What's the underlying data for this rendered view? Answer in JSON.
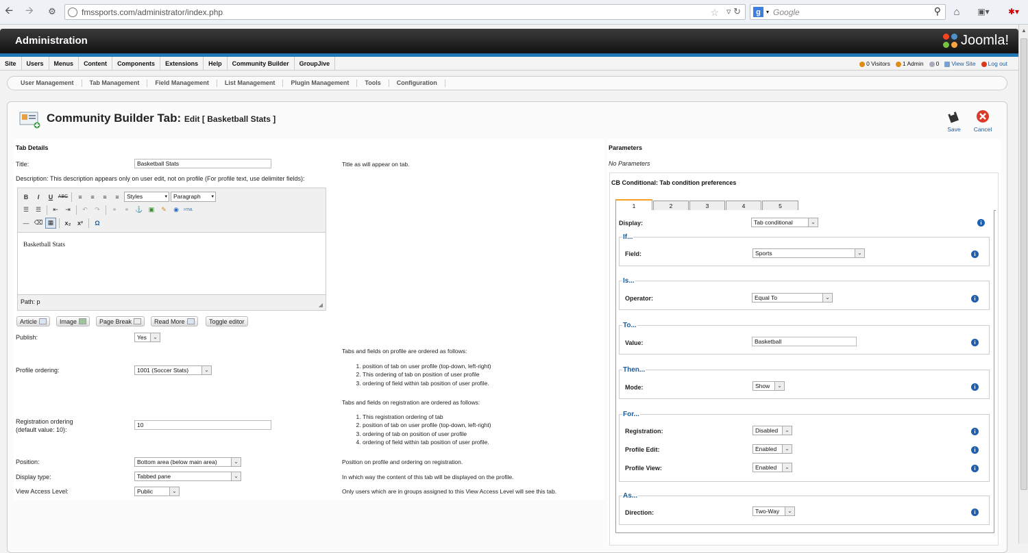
{
  "browser": {
    "url": "fmssports.com/administrator/index.php",
    "search_engine_letter": "g",
    "search_placeholder": "Google"
  },
  "header": {
    "title": "Administration",
    "logo_text": "Joomla!"
  },
  "menu": {
    "items": [
      "Site",
      "Users",
      "Menus",
      "Content",
      "Components",
      "Extensions",
      "Help",
      "Community Builder",
      "GroupJive"
    ],
    "visitors": "0 Visitors",
    "admin": "1 Admin",
    "messages": "0",
    "view_site": "View Site",
    "logout": "Log out"
  },
  "submenu": [
    "User Management",
    "Tab Management",
    "Field Management",
    "List Management",
    "Plugin Management",
    "Tools",
    "Configuration"
  ],
  "page": {
    "title_main": "Community Builder Tab:",
    "title_sub": "Edit [ Basketball Stats ]",
    "save_label": "Save",
    "cancel_label": "Cancel"
  },
  "tab_details": {
    "heading": "Tab Details",
    "title_label": "Title:",
    "title_value": "Basketball Stats",
    "title_help": "Title as will appear on tab.",
    "description_label": "Description: This description appears only on user edit, not on profile (For profile text, use delimiter fields):",
    "editor": {
      "styles": "Styles",
      "paragraph": "Paragraph",
      "content": "Basketball Stats",
      "path": "Path: p"
    },
    "buttons": {
      "article": "Article",
      "image": "Image",
      "page_break": "Page Break",
      "read_more": "Read More",
      "toggle_editor": "Toggle editor"
    },
    "publish_label": "Publish:",
    "publish_value": "Yes",
    "profile_ordering_label": "Profile ordering:",
    "profile_ordering_value": "1001 (Soccer Stats)",
    "profile_help_heading": "Tabs and fields on profile are ordered as follows:",
    "profile_help_items": [
      "position of tab on user profile (top-down, left-right)",
      "This ordering of tab on position of user profile",
      "ordering of field within tab position of user profile."
    ],
    "registration_label_1": "Registration ordering",
    "registration_label_2": "(default value: 10):",
    "registration_value": "10",
    "registration_help_heading": "Tabs and fields on registration are ordered as follows:",
    "registration_help_items": [
      "This registration ordering of tab",
      "position of tab on user profile (top-down, left-right)",
      "ordering of tab on position of user profile",
      "ordering of field within tab position of user profile."
    ],
    "position_label": "Position:",
    "position_value": "Bottom area (below main area)",
    "position_help": "Position on profile and ordering on registration.",
    "display_type_label": "Display type:",
    "display_type_value": "Tabbed pane",
    "display_type_help": "In which way the content of this tab will be displayed on the profile.",
    "access_label": "View Access Level:",
    "access_value": "Public",
    "access_help": "Only users which are in groups assigned to this View Access Level will see this tab."
  },
  "parameters": {
    "heading": "Parameters",
    "none": "No Parameters",
    "cb_heading": "CB Conditional: Tab condition preferences",
    "tabs": [
      "1",
      "2",
      "3",
      "4",
      "5"
    ],
    "display_label": "Display:",
    "display_value": "Tab conditional",
    "if_legend": "If...",
    "field_label": "Field:",
    "field_value": "Sports",
    "is_legend": "Is...",
    "operator_label": "Operator:",
    "operator_value": "Equal To",
    "to_legend": "To...",
    "value_label": "Value:",
    "value_value": "Basketball",
    "then_legend": "Then...",
    "mode_label": "Mode:",
    "mode_value": "Show",
    "for_legend": "For...",
    "registration_label": "Registration:",
    "registration_value": "Disabled",
    "profile_edit_label": "Profile Edit:",
    "profile_edit_value": "Enabled",
    "profile_view_label": "Profile View:",
    "profile_view_value": "Enabled",
    "as_legend": "As...",
    "direction_label": "Direction:",
    "direction_value": "Two-Way",
    "info_glyph": "i"
  },
  "colors": {
    "accent_blue": "#1f77b5",
    "tab_active": "#f8a020",
    "link": "#1a5a9a"
  }
}
